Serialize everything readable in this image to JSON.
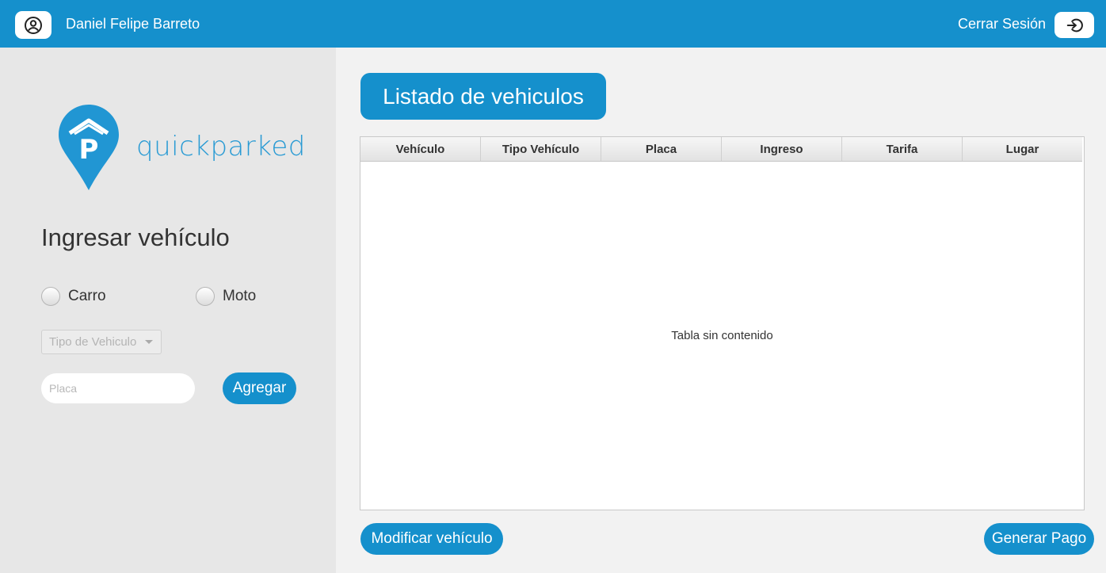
{
  "header": {
    "user_icon": "user-circle-icon",
    "user_name": "Daniel Felipe Barreto",
    "logout_label": "Cerrar Sesión",
    "logout_icon": "logout-icon",
    "bar_color": "#1590cc"
  },
  "sidebar": {
    "logo_text": "quickparked",
    "logo_icon": "parking-pin-icon",
    "title": "Ingresar vehículo",
    "radio_carro": "Carro",
    "radio_moto": "Moto",
    "vehicle_type_select": "Tipo de Vehiculo",
    "plate_placeholder": "Placa",
    "add_button": "Agregar"
  },
  "main": {
    "title": "Listado de vehiculos",
    "table": {
      "columns": [
        "Vehículo",
        "Tipo Vehículo",
        "Placa",
        "Ingreso",
        "Tarifa",
        "Lugar"
      ],
      "rows": [],
      "empty_text": "Tabla sin contenido"
    },
    "modify_button": "Modificar vehículo",
    "pay_button": "Generar Pago"
  }
}
